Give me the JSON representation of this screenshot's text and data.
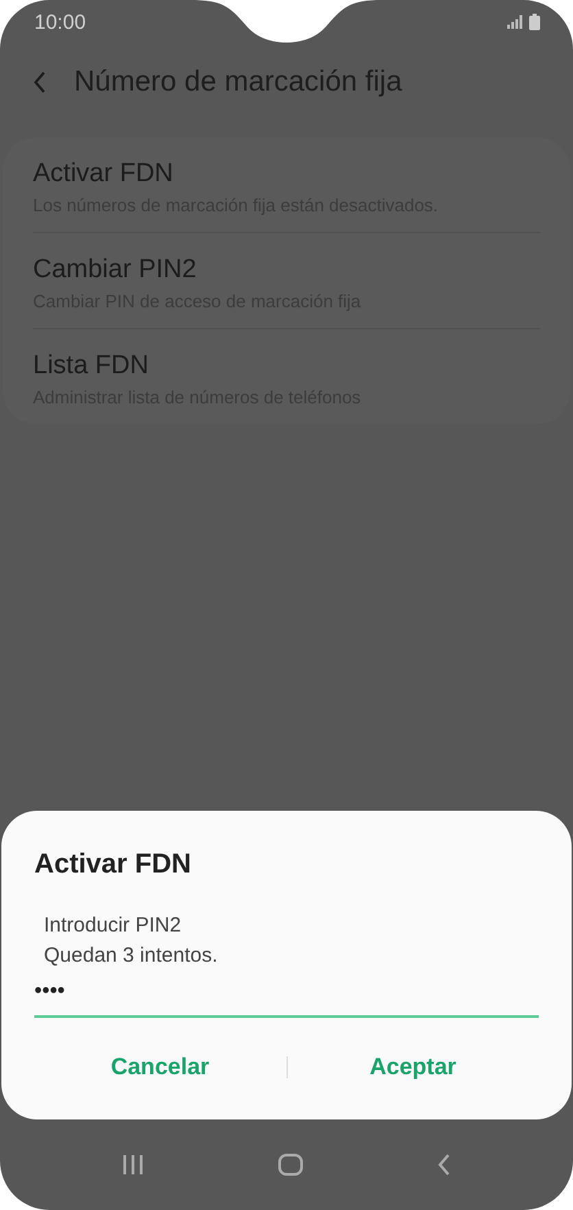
{
  "status_bar": {
    "time": "10:00"
  },
  "header": {
    "title": "Número de marcación fija"
  },
  "settings": [
    {
      "title": "Activar FDN",
      "subtitle": "Los números de marcación fija están desactivados."
    },
    {
      "title": "Cambiar PIN2",
      "subtitle": "Cambiar PIN de acceso de marcación fija"
    },
    {
      "title": "Lista FDN",
      "subtitle": "Administrar lista de números de teléfonos"
    }
  ],
  "dialog": {
    "title": "Activar FDN",
    "message_lines": [
      "Introducir PIN2",
      "Quedan 3 intentos."
    ],
    "pin_value": "••••",
    "buttons": [
      "Cancelar",
      "Aceptar"
    ]
  }
}
